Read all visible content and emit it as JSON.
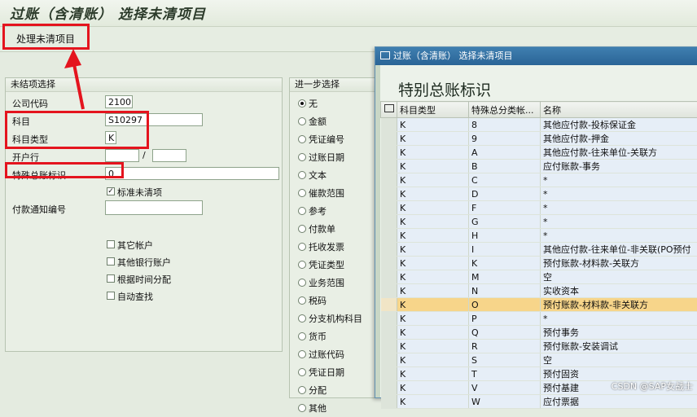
{
  "window_title": "过账（含清账） 选择未清项目",
  "toolbar": {
    "process_open_items": "处理未清项目"
  },
  "open_item_group": {
    "title": "未结项选择",
    "company_code_label": "公司代码",
    "company_code": "2100",
    "account_label": "科目",
    "account": "S10297",
    "account_type_label": "科目类型",
    "account_type": "K",
    "bank_label": "开户行",
    "bank_sep": "/",
    "sgl_label": "特殊总账标识",
    "sgl": "0",
    "standard_open_label": "标准未清项",
    "standard_open_mark": "✓",
    "payment_advice_label": "付款通知编号",
    "other_accounts": "其它帐户",
    "other_bank_accounts": "其他银行账户",
    "time_distribution": "根据时间分配",
    "auto_search": "自动查找"
  },
  "further_selection": {
    "title": "进一步选择",
    "options": [
      "无",
      "金额",
      "凭证编号",
      "过账日期",
      "文本",
      "催款范围",
      "参考",
      "付款单",
      "托收发票",
      "凭证类型",
      "业务范围",
      "税码",
      "分支机构科目",
      "货币",
      "过账代码",
      "凭证日期",
      "分配",
      "其他"
    ]
  },
  "popup": {
    "title": "过账（含清账） 选择未清项目",
    "heading": "特别总账标识",
    "columns": [
      "科目类型",
      "特殊总分类帐...",
      "名称"
    ],
    "rows": [
      [
        "K",
        "8",
        "其他应付款-投标保证金"
      ],
      [
        "K",
        "9",
        "其他应付款-押金"
      ],
      [
        "K",
        "A",
        "其他应付款-往来单位-关联方"
      ],
      [
        "K",
        "B",
        "应付账款-事务"
      ],
      [
        "K",
        "C",
        "*"
      ],
      [
        "K",
        "D",
        "*"
      ],
      [
        "K",
        "F",
        "*"
      ],
      [
        "K",
        "G",
        "*"
      ],
      [
        "K",
        "H",
        "*"
      ],
      [
        "K",
        "I",
        "其他应付款-往来单位-非关联(PO预付"
      ],
      [
        "K",
        "K",
        "预付账款-材料款-关联方"
      ],
      [
        "K",
        "M",
        "空"
      ],
      [
        "K",
        "N",
        "实收资本"
      ],
      [
        "K",
        "O",
        "预付账款-材料款-非关联方"
      ],
      [
        "K",
        "P",
        "*"
      ],
      [
        "K",
        "Q",
        "预付事务"
      ],
      [
        "K",
        "R",
        "预付账款-安装调试"
      ],
      [
        "K",
        "S",
        "空"
      ],
      [
        "K",
        "T",
        "预付固资"
      ],
      [
        "K",
        "V",
        "预付基建"
      ],
      [
        "K",
        "W",
        "应付票据"
      ]
    ],
    "highlighted_row": 13
  },
  "watermark": "CSDN @SAP女战士"
}
